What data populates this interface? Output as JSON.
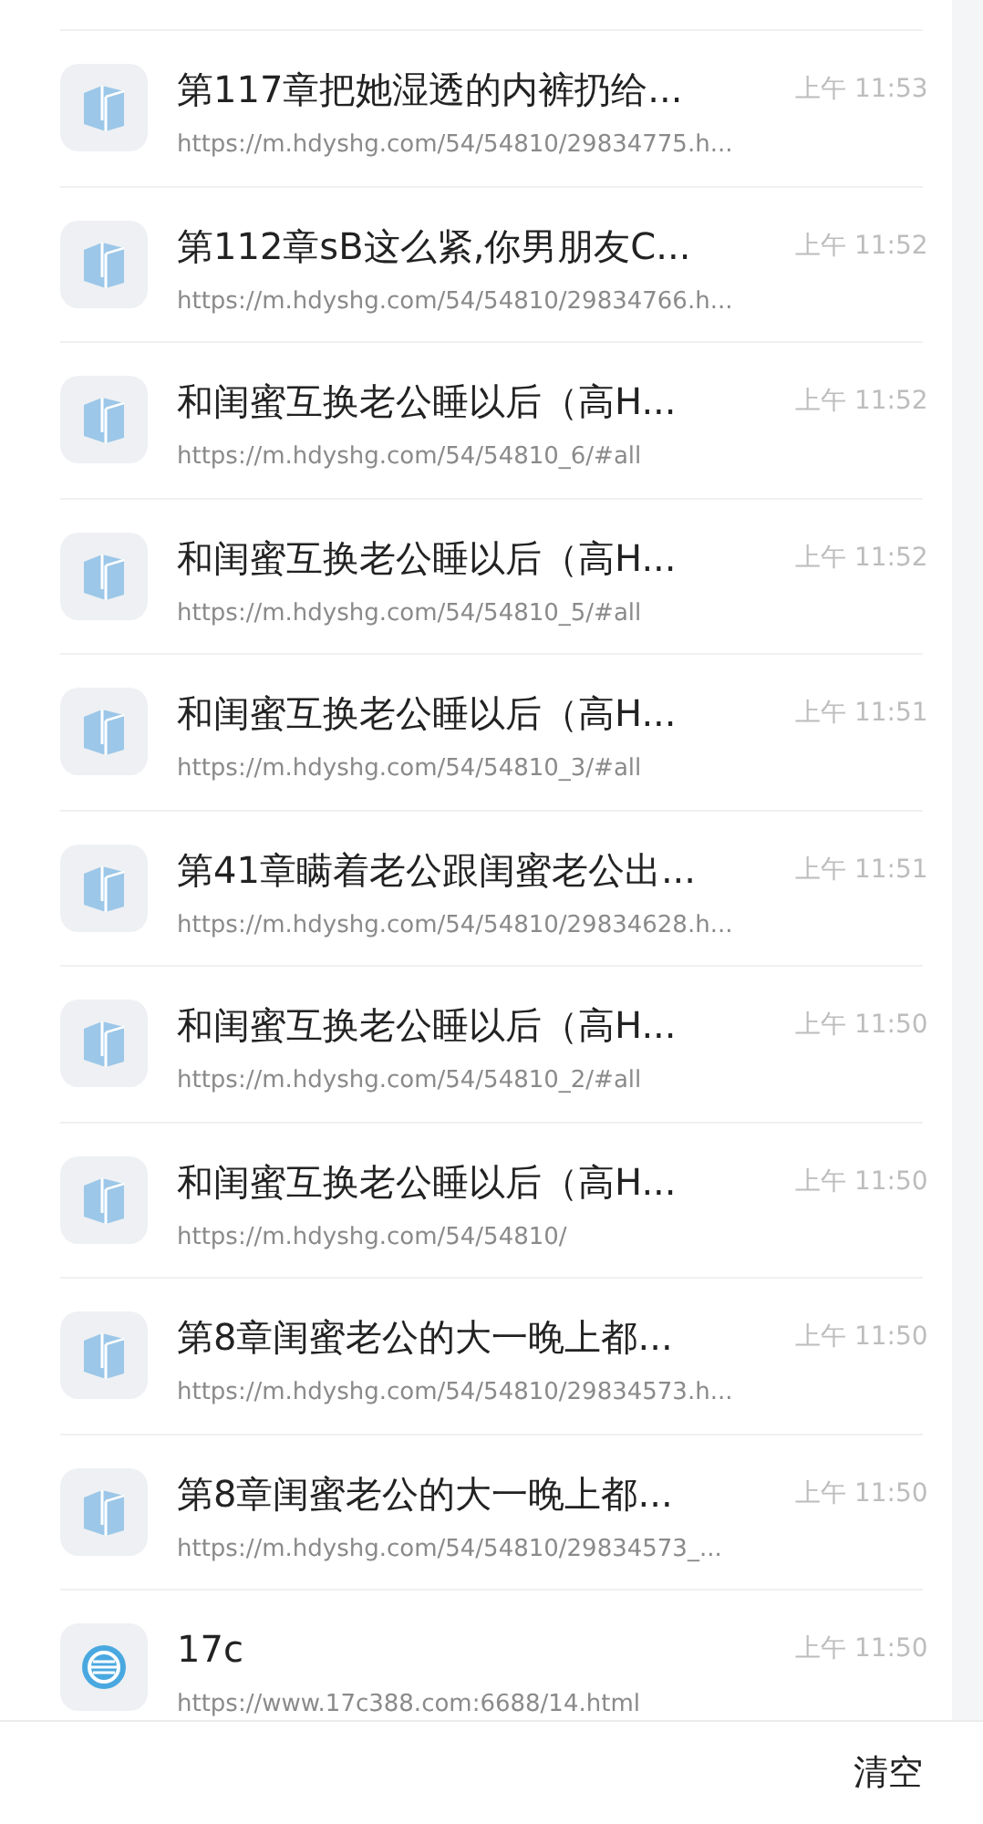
{
  "history": [
    {
      "kind": "book",
      "title": "第117章把她湿透的内裤扔给...",
      "url": "https://m.hdyshg.com/54/54810/29834775.h...",
      "time": "上午 11:53"
    },
    {
      "kind": "book",
      "title": "第112章sB这么紧,你男朋友C...",
      "url": "https://m.hdyshg.com/54/54810/29834766.h...",
      "time": "上午 11:52"
    },
    {
      "kind": "book",
      "title": "和闺蜜互换老公睡以后（高H...",
      "url": "https://m.hdyshg.com/54/54810_6/#all",
      "time": "上午 11:52"
    },
    {
      "kind": "book",
      "title": "和闺蜜互换老公睡以后（高H...",
      "url": "https://m.hdyshg.com/54/54810_5/#all",
      "time": "上午 11:52"
    },
    {
      "kind": "book",
      "title": "和闺蜜互换老公睡以后（高H...",
      "url": "https://m.hdyshg.com/54/54810_3/#all",
      "time": "上午 11:51"
    },
    {
      "kind": "book",
      "title": "第41章瞒着老公跟闺蜜老公出...",
      "url": "https://m.hdyshg.com/54/54810/29834628.h...",
      "time": "上午 11:51"
    },
    {
      "kind": "book",
      "title": "和闺蜜互换老公睡以后（高H...",
      "url": "https://m.hdyshg.com/54/54810_2/#all",
      "time": "上午 11:50"
    },
    {
      "kind": "book",
      "title": "和闺蜜互换老公睡以后（高H...",
      "url": "https://m.hdyshg.com/54/54810/",
      "time": "上午 11:50"
    },
    {
      "kind": "book",
      "title": "第8章闺蜜老公的大一晚上都...",
      "url": "https://m.hdyshg.com/54/54810/29834573.h...",
      "time": "上午 11:50"
    },
    {
      "kind": "book",
      "title": "第8章闺蜜老公的大一晚上都...",
      "url": "https://m.hdyshg.com/54/54810/29834573_...",
      "time": "上午 11:50"
    },
    {
      "kind": "site",
      "title": "17c",
      "url": "https://www.17c388.com:6688/14.html",
      "time": "上午 11:50"
    }
  ],
  "footer": {
    "clear_button": "清空"
  }
}
